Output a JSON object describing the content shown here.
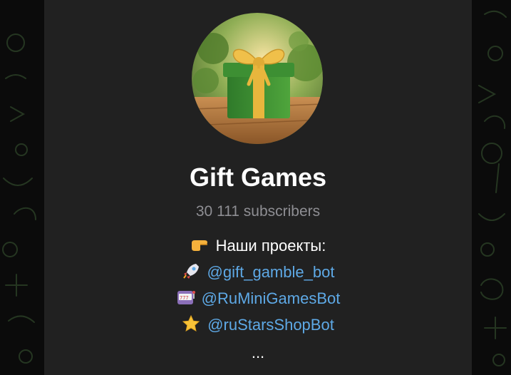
{
  "channel": {
    "name": "Gift Games",
    "subscribers": "30 111 subscribers",
    "avatar_icon": "gift-box-icon"
  },
  "description": {
    "heading": "Наши проекты:",
    "heading_icon": "pointing-hand-icon",
    "links": [
      {
        "icon": "rocket-icon",
        "text": "@gift_gamble_bot"
      },
      {
        "icon": "slot-machine-icon",
        "text": "@RuMiniGamesBot"
      },
      {
        "icon": "star-icon",
        "text": "@ruStarsShopBot"
      }
    ],
    "more": "..."
  },
  "colors": {
    "panel": "#212121",
    "link": "#5ea9e6",
    "muted": "#8e8e93",
    "background": "#0b0b0b"
  }
}
